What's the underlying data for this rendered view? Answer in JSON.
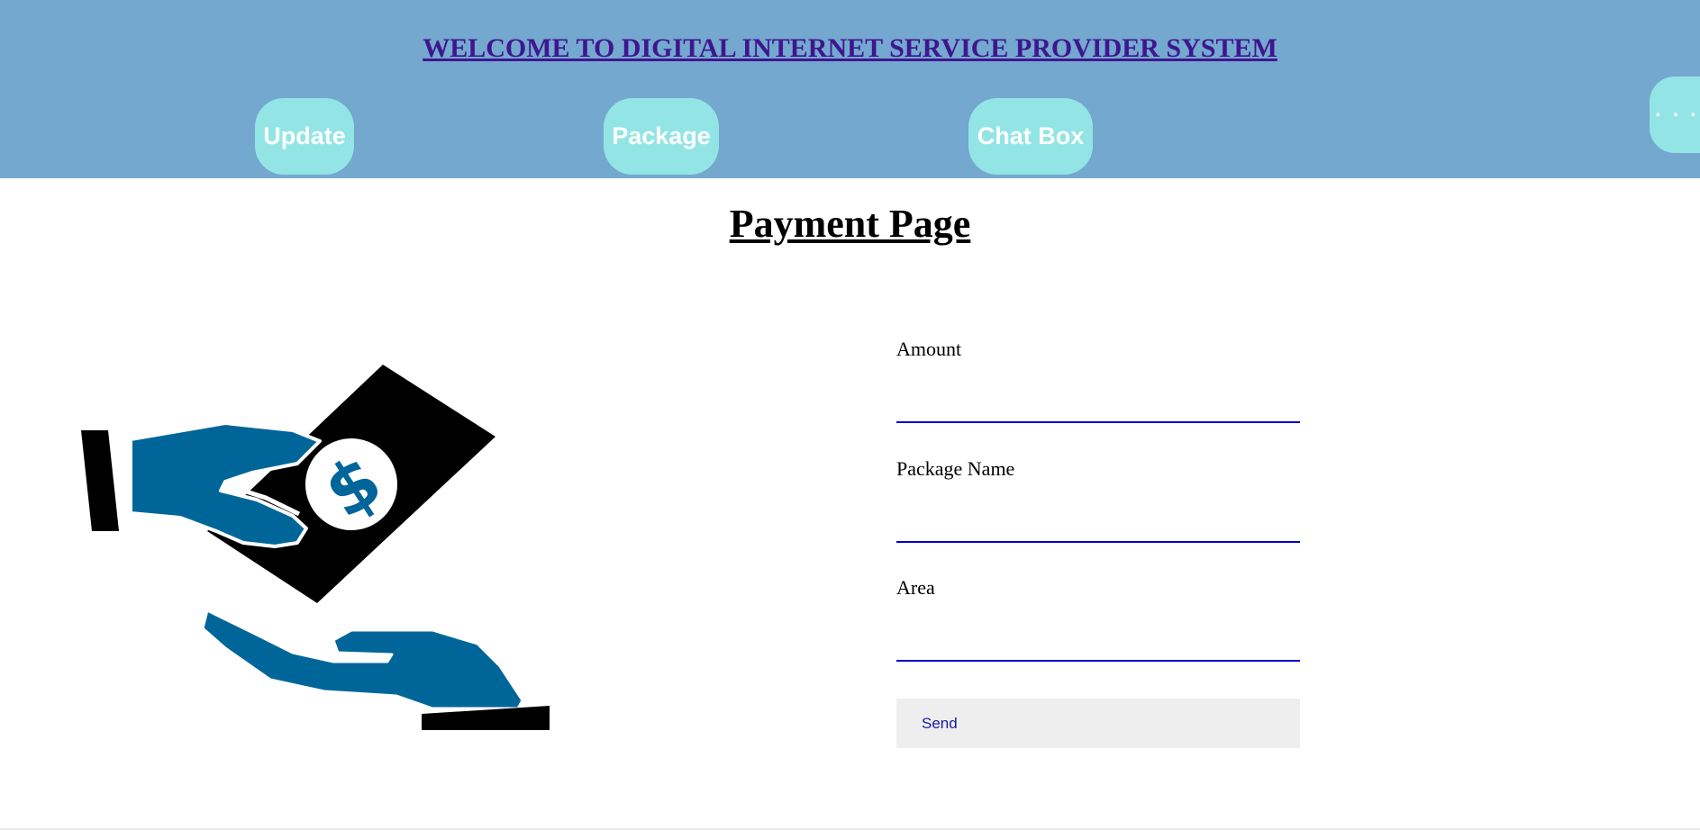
{
  "header": {
    "title": "WELCOME TO DIGITAL INTERNET SERVICE PROVIDER SYSTEM",
    "background_color": "#74a8cf",
    "nav": {
      "update_label": "Update",
      "package_label": "Package",
      "chat_label": "Chat Box",
      "more_label": "· · ·"
    }
  },
  "main": {
    "page_title": "Payment Page",
    "illustration_icon": "hand-giving-money-icon",
    "form": {
      "amount_label": "Amount",
      "amount_value": "",
      "package_name_label": "Package Name",
      "package_name_value": "",
      "area_label": "Area",
      "area_value": "",
      "send_label": "Send"
    }
  },
  "colors": {
    "title": "#3f168f",
    "nav_button": "#93e5e5",
    "input_underline": "#0000c8",
    "hand": "#00669a"
  }
}
